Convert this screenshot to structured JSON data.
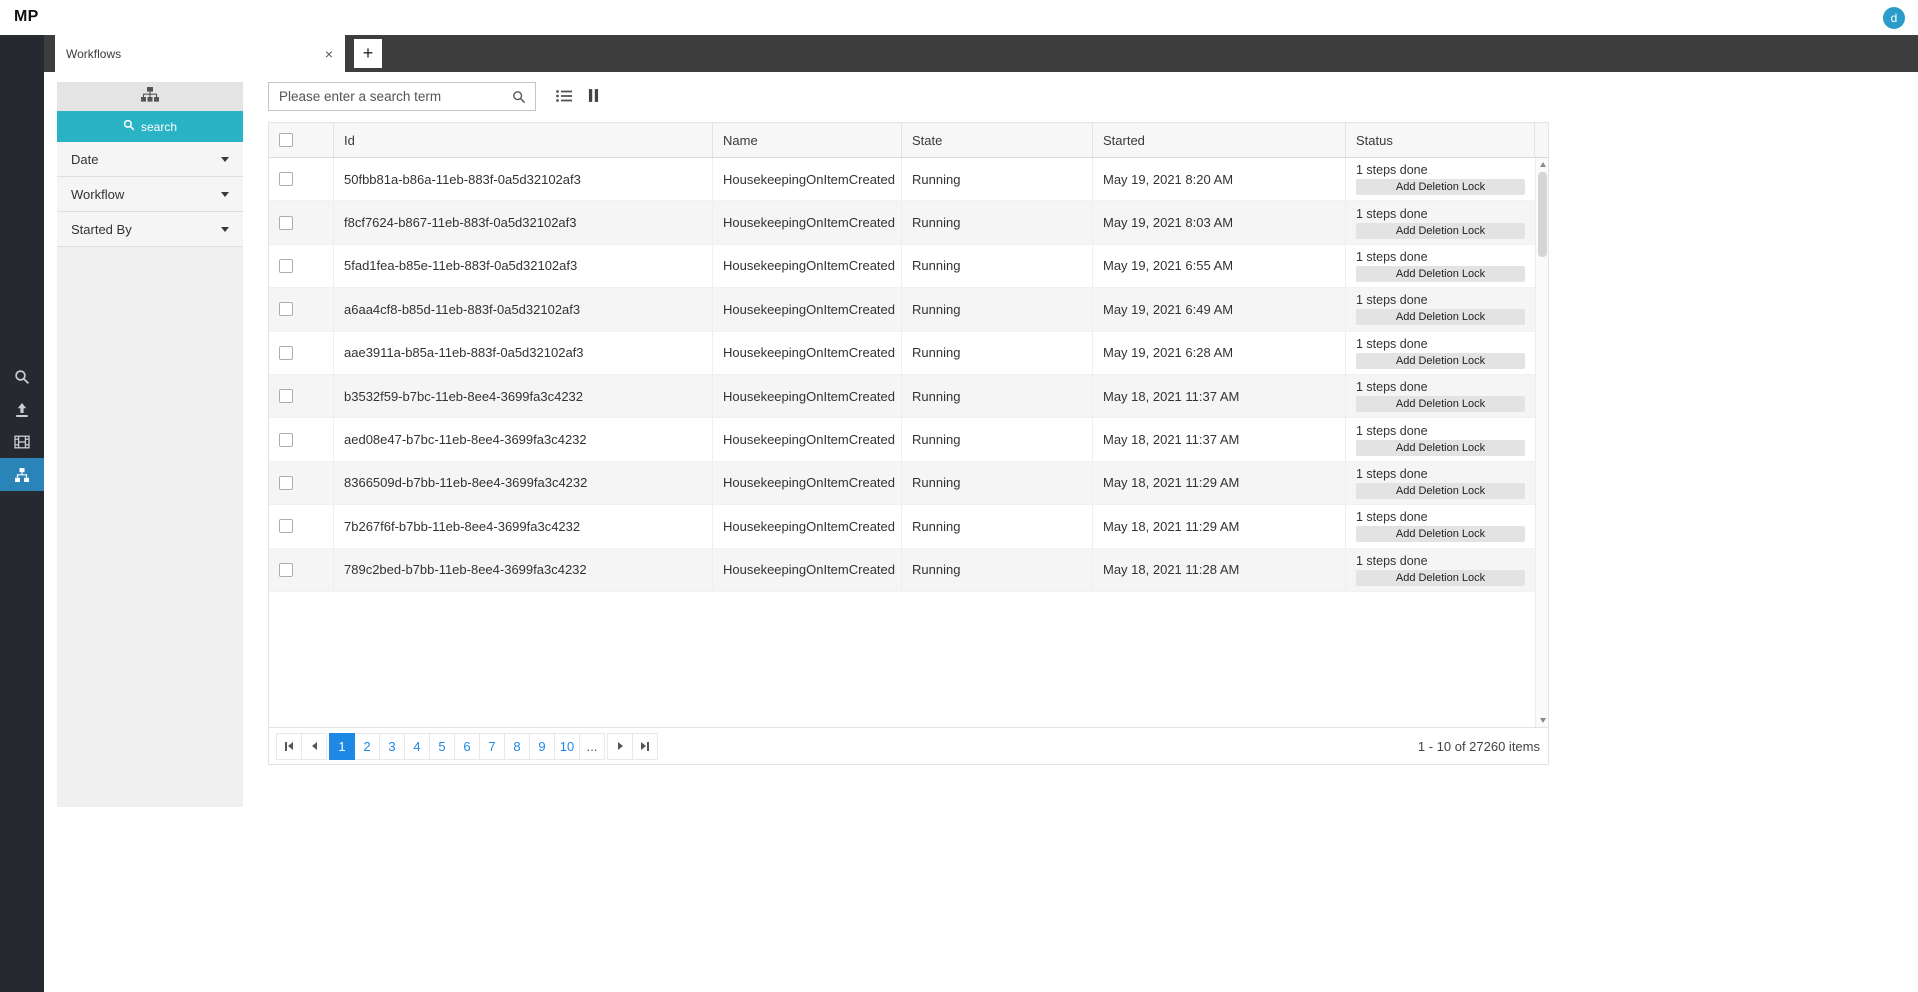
{
  "topbar": {
    "logo": "MP",
    "avatar_initial": "d"
  },
  "tabbar": {
    "tabs": [
      {
        "label": "Workflows",
        "close": "×"
      }
    ],
    "new_tab": "+"
  },
  "filter_panel": {
    "search_button_label": "search",
    "sections": [
      {
        "label": "Date"
      },
      {
        "label": "Workflow"
      },
      {
        "label": "Started By"
      }
    ]
  },
  "toolbar": {
    "search_placeholder": "Please enter a search term"
  },
  "table": {
    "columns": [
      "Id",
      "Name",
      "State",
      "Started",
      "Status"
    ],
    "rows": [
      {
        "id": "50fbb81a-b86a-11eb-883f-0a5d32102af3",
        "name": "HousekeepingOnItemCreated",
        "state": "Running",
        "started": "May 19, 2021 8:20 AM",
        "status": "1 steps done",
        "action": "Add Deletion Lock"
      },
      {
        "id": "f8cf7624-b867-11eb-883f-0a5d32102af3",
        "name": "HousekeepingOnItemCreated",
        "state": "Running",
        "started": "May 19, 2021 8:03 AM",
        "status": "1 steps done",
        "action": "Add Deletion Lock"
      },
      {
        "id": "5fad1fea-b85e-11eb-883f-0a5d32102af3",
        "name": "HousekeepingOnItemCreated",
        "state": "Running",
        "started": "May 19, 2021 6:55 AM",
        "status": "1 steps done",
        "action": "Add Deletion Lock"
      },
      {
        "id": "a6aa4cf8-b85d-11eb-883f-0a5d32102af3",
        "name": "HousekeepingOnItemCreated",
        "state": "Running",
        "started": "May 19, 2021 6:49 AM",
        "status": "1 steps done",
        "action": "Add Deletion Lock"
      },
      {
        "id": "aae3911a-b85a-11eb-883f-0a5d32102af3",
        "name": "HousekeepingOnItemCreated",
        "state": "Running",
        "started": "May 19, 2021 6:28 AM",
        "status": "1 steps done",
        "action": "Add Deletion Lock"
      },
      {
        "id": "b3532f59-b7bc-11eb-8ee4-3699fa3c4232",
        "name": "HousekeepingOnItemCreated",
        "state": "Running",
        "started": "May 18, 2021 11:37 AM",
        "status": "1 steps done",
        "action": "Add Deletion Lock"
      },
      {
        "id": "aed08e47-b7bc-11eb-8ee4-3699fa3c4232",
        "name": "HousekeepingOnItemCreated",
        "state": "Running",
        "started": "May 18, 2021 11:37 AM",
        "status": "1 steps done",
        "action": "Add Deletion Lock"
      },
      {
        "id": "8366509d-b7bb-11eb-8ee4-3699fa3c4232",
        "name": "HousekeepingOnItemCreated",
        "state": "Running",
        "started": "May 18, 2021 11:29 AM",
        "status": "1 steps done",
        "action": "Add Deletion Lock"
      },
      {
        "id": "7b267f6f-b7bb-11eb-8ee4-3699fa3c4232",
        "name": "HousekeepingOnItemCreated",
        "state": "Running",
        "started": "May 18, 2021 11:29 AM",
        "status": "1 steps done",
        "action": "Add Deletion Lock"
      },
      {
        "id": "789c2bed-b7bb-11eb-8ee4-3699fa3c4232",
        "name": "HousekeepingOnItemCreated",
        "state": "Running",
        "started": "May 18, 2021 11:28 AM",
        "status": "1 steps done",
        "action": "Add Deletion Lock"
      }
    ]
  },
  "pagination": {
    "pages": [
      "1",
      "2",
      "3",
      "4",
      "5",
      "6",
      "7",
      "8",
      "9",
      "10",
      "..."
    ],
    "active_page": "1",
    "info": "1 - 10 of 27260 items"
  },
  "icons": {
    "sidebar": [
      "search-icon",
      "upload-icon",
      "film-icon",
      "workflow-icon"
    ],
    "panel": [
      "sitemap-icon",
      "search-icon",
      "chevron-down-icon"
    ],
    "toolbar": [
      "search-icon",
      "list-view-icon",
      "pause-icon"
    ],
    "pager": [
      "first-page-icon",
      "prev-page-icon",
      "next-page-icon",
      "last-page-icon"
    ]
  },
  "colors": {
    "accent_cyan": "#29b3c4",
    "accent_blue": "#1e88e5",
    "sidebar_active": "#2a84b8",
    "avatar": "#2b9cc9"
  }
}
